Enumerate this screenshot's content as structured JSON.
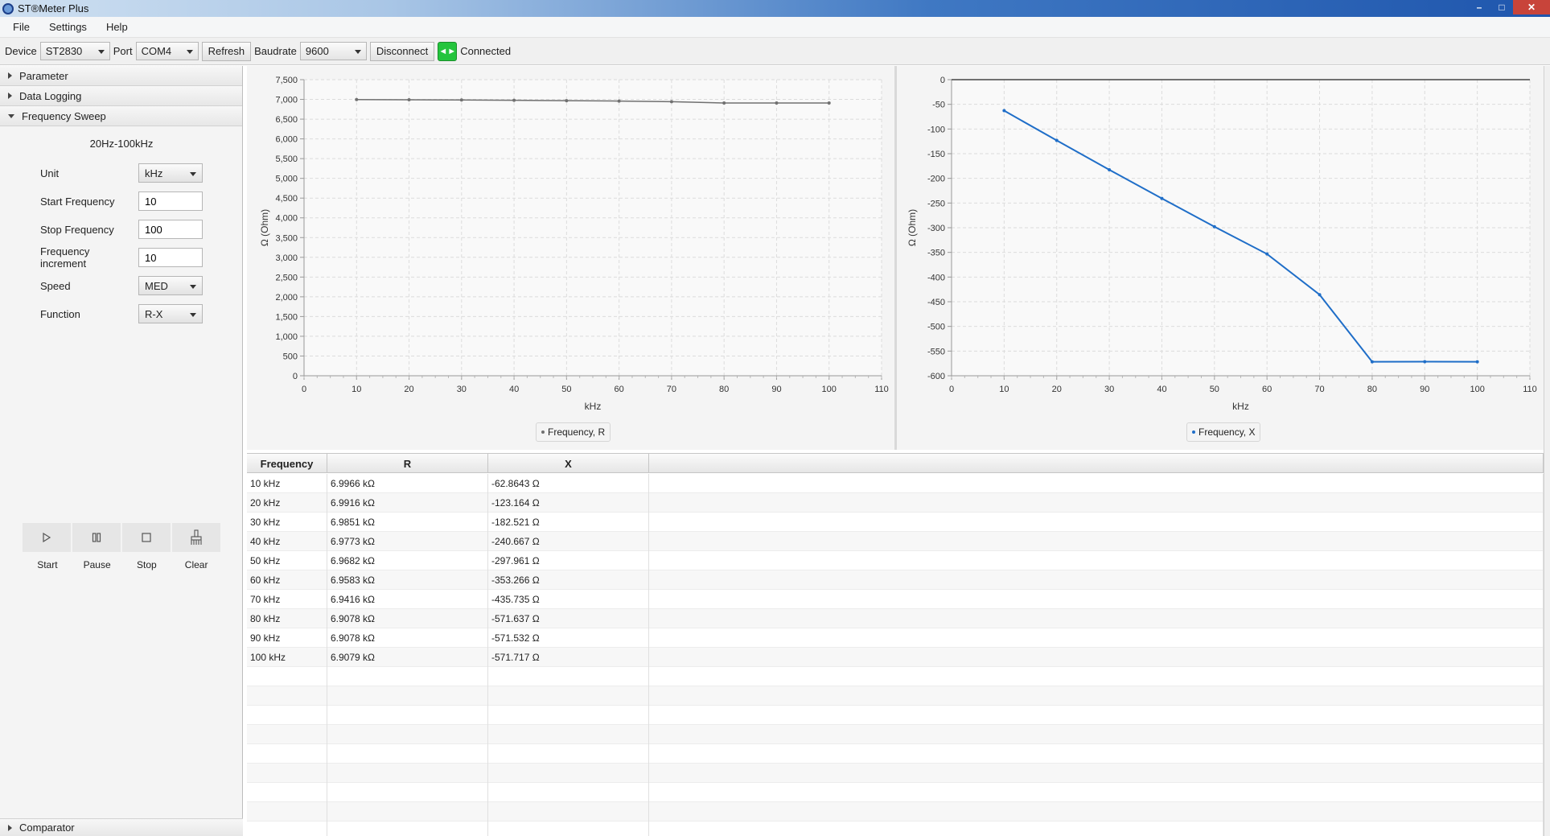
{
  "window": {
    "title": "ST®Meter Plus",
    "controls": [
      "–",
      "□",
      "✕"
    ]
  },
  "menu": [
    "File",
    "Settings",
    "Help"
  ],
  "toolbar": {
    "device_label": "Device",
    "device_value": "ST2830",
    "port_label": "Port",
    "port_value": "COM4",
    "refresh_label": "Refresh",
    "baudrate_label": "Baudrate",
    "baudrate_value": "9600",
    "disconnect_label": "Disconnect",
    "status": "Connected",
    "status_color": "#24c43d"
  },
  "sidebar": {
    "parameter": "Parameter",
    "data_logging": "Data Logging",
    "frequency_sweep": "Frequency Sweep",
    "range": "20Hz-100kHz",
    "unit_label": "Unit",
    "unit_value": "kHz",
    "start_label": "Start Frequency",
    "start_value": "10",
    "stop_label": "Stop Frequency",
    "stop_value": "100",
    "inc_label": "Frequency increment",
    "inc_value": "10",
    "speed_label": "Speed",
    "speed_value": "MED",
    "function_label": "Function",
    "function_value": "R-X",
    "controls": {
      "start": "Start",
      "pause": "Pause",
      "stop": "Stop",
      "clear": "Clear"
    },
    "comparator": "Comparator"
  },
  "chart_data": [
    {
      "type": "line",
      "x": [
        10,
        20,
        30,
        40,
        50,
        60,
        70,
        80,
        90,
        100
      ],
      "series": [
        {
          "name": "Frequency, R",
          "values": [
            6996.6,
            6991.6,
            6985.1,
            6977.3,
            6968.2,
            6958.3,
            6941.6,
            6907.8,
            6907.8,
            6907.9
          ],
          "color": "#707070"
        }
      ],
      "xlabel": "kHz",
      "ylabel": "Ω (Ohm)",
      "xlim": [
        0,
        110
      ],
      "ylim": [
        0,
        7500
      ],
      "xticks": [
        0,
        10,
        20,
        30,
        40,
        50,
        60,
        70,
        80,
        90,
        100,
        110
      ],
      "yticks": [
        "0",
        "500",
        "1,000",
        "1,500",
        "2,000",
        "2,500",
        "3,000",
        "3,500",
        "4,000",
        "4,500",
        "5,000",
        "5,500",
        "6,000",
        "6,500",
        "7,000",
        "7,500"
      ],
      "grid": true,
      "legend": "bottom-center"
    },
    {
      "type": "line",
      "x": [
        10,
        20,
        30,
        40,
        50,
        60,
        70,
        80,
        90,
        100
      ],
      "series": [
        {
          "name": "Frequency, X",
          "values": [
            -62.8643,
            -123.164,
            -182.521,
            -240.667,
            -297.961,
            -353.266,
            -435.735,
            -571.637,
            -571.532,
            -571.717
          ],
          "color": "#1f6ec8"
        }
      ],
      "xlabel": "kHz",
      "ylabel": "Ω (Ohm)",
      "xlim": [
        0,
        110
      ],
      "ylim": [
        -600,
        0
      ],
      "xticks": [
        0,
        10,
        20,
        30,
        40,
        50,
        60,
        70,
        80,
        90,
        100,
        110
      ],
      "yticks": [
        "-600",
        "-550",
        "-500",
        "-450",
        "-400",
        "-350",
        "-300",
        "-250",
        "-200",
        "-150",
        "-100",
        "-50",
        "0"
      ],
      "grid": true,
      "legend": "bottom-center"
    }
  ],
  "table": {
    "headers": [
      "Frequency",
      "R",
      "X"
    ],
    "rows": [
      [
        "10 kHz",
        "6.9966 kΩ",
        "-62.8643 Ω"
      ],
      [
        "20 kHz",
        "6.9916 kΩ",
        "-123.164 Ω"
      ],
      [
        "30 kHz",
        "6.9851 kΩ",
        "-182.521 Ω"
      ],
      [
        "40 kHz",
        "6.9773 kΩ",
        "-240.667 Ω"
      ],
      [
        "50 kHz",
        "6.9682 kΩ",
        "-297.961 Ω"
      ],
      [
        "60 kHz",
        "6.9583 kΩ",
        "-353.266 Ω"
      ],
      [
        "70 kHz",
        "6.9416 kΩ",
        "-435.735 Ω"
      ],
      [
        "80 kHz",
        "6.9078 kΩ",
        "-571.637 Ω"
      ],
      [
        "90 kHz",
        "6.9078 kΩ",
        "-571.532 Ω"
      ],
      [
        "100 kHz",
        "6.9079 kΩ",
        "-571.717 Ω"
      ]
    ]
  }
}
